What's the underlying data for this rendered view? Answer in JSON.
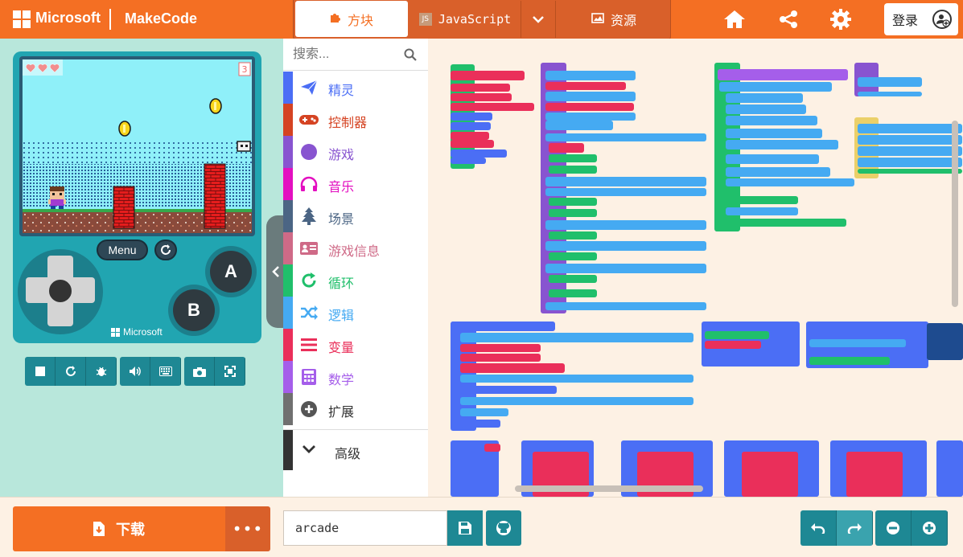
{
  "header": {
    "brand": "Microsoft",
    "product": "MakeCode",
    "tabs": {
      "blocks": "方块",
      "javascript": "JavaScript",
      "assets": "资源"
    },
    "login_label": "登录"
  },
  "simulator": {
    "menu_label": "Menu",
    "a_label": "A",
    "b_label": "B",
    "brand_label": "Microsoft",
    "score_digit": "3"
  },
  "toolbox": {
    "search_placeholder": "搜索...",
    "categories": [
      {
        "label": "精灵",
        "color": "#4b6ef5",
        "icon": "paper-plane-icon"
      },
      {
        "label": "控制器",
        "color": "#d54322",
        "icon": "gamepad-icon"
      },
      {
        "label": "游戏",
        "color": "#8854d0",
        "icon": "circle-icon"
      },
      {
        "label": "音乐",
        "color": "#e30fc0",
        "icon": "headphones-icon"
      },
      {
        "label": "场景",
        "color": "#4b6584",
        "icon": "tree-icon"
      },
      {
        "label": "游戏信息",
        "color": "#cf6a87",
        "icon": "id-card-icon"
      },
      {
        "label": "循环",
        "color": "#20bf6b",
        "icon": "refresh-icon"
      },
      {
        "label": "逻辑",
        "color": "#45aaf2",
        "icon": "shuffle-icon"
      },
      {
        "label": "变量",
        "color": "#ea2f5a",
        "icon": "list-icon"
      },
      {
        "label": "数学",
        "color": "#a55eea",
        "icon": "calculator-icon"
      },
      {
        "label": "扩展",
        "color": "#707070",
        "icon": "plus-circle-icon"
      }
    ],
    "advanced_label": "高级"
  },
  "footer": {
    "download_label": "下载",
    "more_label": "•••",
    "project_name": "arcade"
  }
}
